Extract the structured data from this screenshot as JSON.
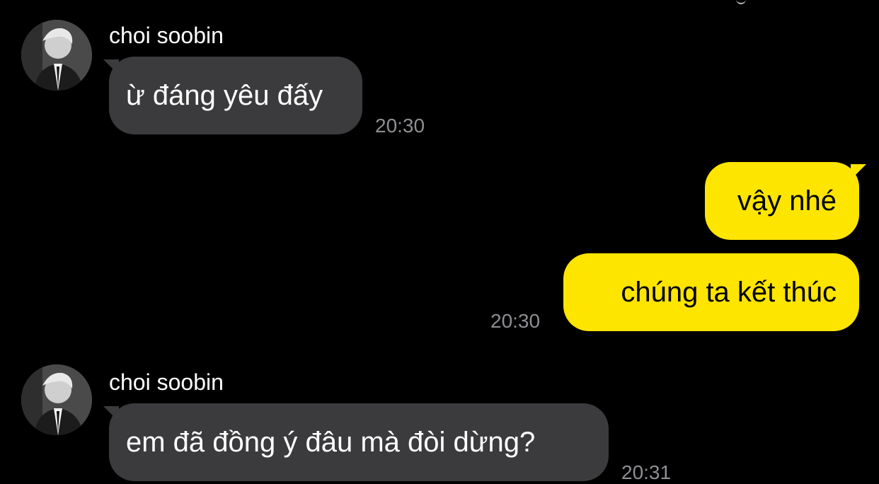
{
  "chat": {
    "messages": [
      {
        "sender": "choi soobin",
        "direction": "incoming",
        "text": "ừ đáng yêu đấy",
        "time": "20:30",
        "avatar": "profile-photo-icon"
      },
      {
        "direction": "outgoing",
        "text": "vậy nhé"
      },
      {
        "direction": "outgoing",
        "text": "chúng ta kết thúc",
        "time": "20:30"
      },
      {
        "sender": "choi soobin",
        "direction": "incoming",
        "text": "em đã đồng ý đâu mà đòi dừng?",
        "time": "20:31",
        "avatar": "profile-photo-icon"
      }
    ]
  },
  "colors": {
    "background": "#000000",
    "incoming_bubble": "#3b3b3d",
    "outgoing_bubble": "#fee500",
    "timestamp": "#8e8e93"
  }
}
